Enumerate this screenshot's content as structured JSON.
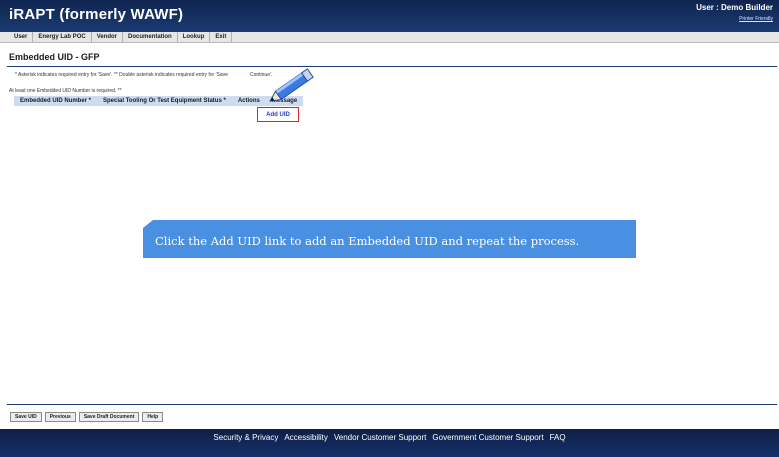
{
  "header": {
    "app_title": "iRAPT (formerly WAWF)",
    "user_label": "User : Demo Builder",
    "printer_friendly": "Printer Friendly"
  },
  "menu": {
    "items": [
      "User",
      "Energy Lab POC",
      "Vendor",
      "Documentation",
      "Lookup",
      "Exit"
    ]
  },
  "page": {
    "title": "Embedded UID - GFP",
    "note_asterisk_start": "* Asterisk indicates required entry for 'Save'.  ** Double asterisk indicates required entry for 'Save",
    "note_asterisk_end": "Continue'.",
    "note_required": "At least one Embedded UID Number is required. **"
  },
  "table": {
    "headers": [
      "Embedded UID Number *",
      "Special Tooling Or Test Equipment Status *",
      "Actions",
      "Message"
    ],
    "add_uid_label": "Add UID"
  },
  "tooltip": {
    "text": "Click the Add UID link to add an Embedded UID and repeat the process."
  },
  "buttons": {
    "save_uid": "Save UID",
    "previous": "Previous",
    "save_draft": "Save Draft Document",
    "help": "Help"
  },
  "footer": {
    "links": [
      "Security & Privacy",
      "Accessibility",
      "Vendor Customer Support",
      "Government Customer Support",
      "FAQ"
    ]
  },
  "colors": {
    "header_bg": "#1b3a72",
    "tooltip_bg": "#4a90e2",
    "highlight_border": "#d62626",
    "link": "#1d3cc5"
  }
}
